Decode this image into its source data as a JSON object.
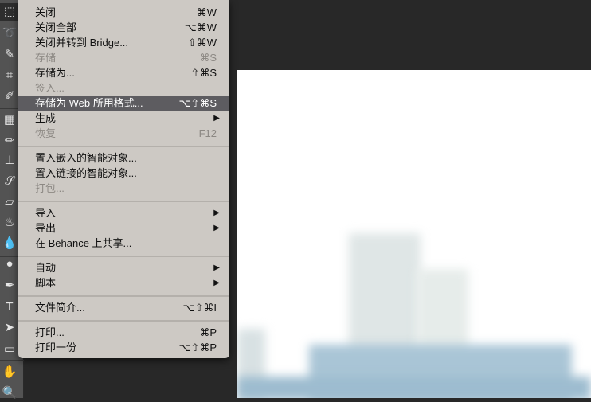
{
  "tools": [
    {
      "name": "marquee-icon",
      "glyph": "⬚"
    },
    {
      "name": "lasso-icon",
      "glyph": "➰"
    },
    {
      "name": "quick-select-icon",
      "glyph": "✎"
    },
    {
      "name": "crop-icon",
      "glyph": "⌗"
    },
    {
      "name": "eyedropper-icon",
      "glyph": "✐"
    },
    {
      "name": "healing-brush-icon",
      "glyph": "▦"
    },
    {
      "name": "brush-icon",
      "glyph": "✏"
    },
    {
      "name": "stamp-icon",
      "glyph": "⊥"
    },
    {
      "name": "history-brush-icon",
      "glyph": "𝒮"
    },
    {
      "name": "eraser-icon",
      "glyph": "▱"
    },
    {
      "name": "paint-bucket-icon",
      "glyph": "♨"
    },
    {
      "name": "blur-icon",
      "glyph": "💧"
    },
    {
      "name": "dodge-icon",
      "glyph": "●"
    },
    {
      "name": "pen-icon",
      "glyph": "✒"
    },
    {
      "name": "type-icon",
      "glyph": "T"
    },
    {
      "name": "path-select-icon",
      "glyph": "➤"
    },
    {
      "name": "rectangle-icon",
      "glyph": "▭"
    },
    {
      "name": "hand-icon",
      "glyph": "✋"
    },
    {
      "name": "zoom-icon",
      "glyph": "🔍"
    }
  ],
  "menu": {
    "items": [
      {
        "label": "关闭",
        "shortcut": "⌘W"
      },
      {
        "label": "关闭全部",
        "shortcut": "⌥⌘W"
      },
      {
        "label": "关闭并转到 Bridge...",
        "shortcut": "⇧⌘W"
      },
      {
        "label": "存储",
        "shortcut": "⌘S",
        "disabled": true
      },
      {
        "label": "存储为...",
        "shortcut": "⇧⌘S"
      },
      {
        "label": "签入...",
        "disabled": true
      },
      {
        "label": "存储为 Web 所用格式...",
        "shortcut": "⌥⇧⌘S",
        "highlighted": true
      },
      {
        "label": "生成",
        "submenu": true
      },
      {
        "label": "恢复",
        "shortcut": "F12",
        "disabled": true
      },
      {
        "separator": true
      },
      {
        "label": "置入嵌入的智能对象..."
      },
      {
        "label": "置入链接的智能对象..."
      },
      {
        "label": "打包...",
        "disabled": true
      },
      {
        "separator": true
      },
      {
        "label": "导入",
        "submenu": true
      },
      {
        "label": "导出",
        "submenu": true
      },
      {
        "label": "在 Behance 上共享..."
      },
      {
        "separator": true
      },
      {
        "label": "自动",
        "submenu": true
      },
      {
        "label": "脚本",
        "submenu": true
      },
      {
        "separator": true
      },
      {
        "label": "文件简介...",
        "shortcut": "⌥⇧⌘I"
      },
      {
        "separator": true
      },
      {
        "label": "打印...",
        "shortcut": "⌘P"
      },
      {
        "label": "打印一份",
        "shortcut": "⌥⇧⌘P"
      }
    ],
    "arrow": "▶"
  }
}
